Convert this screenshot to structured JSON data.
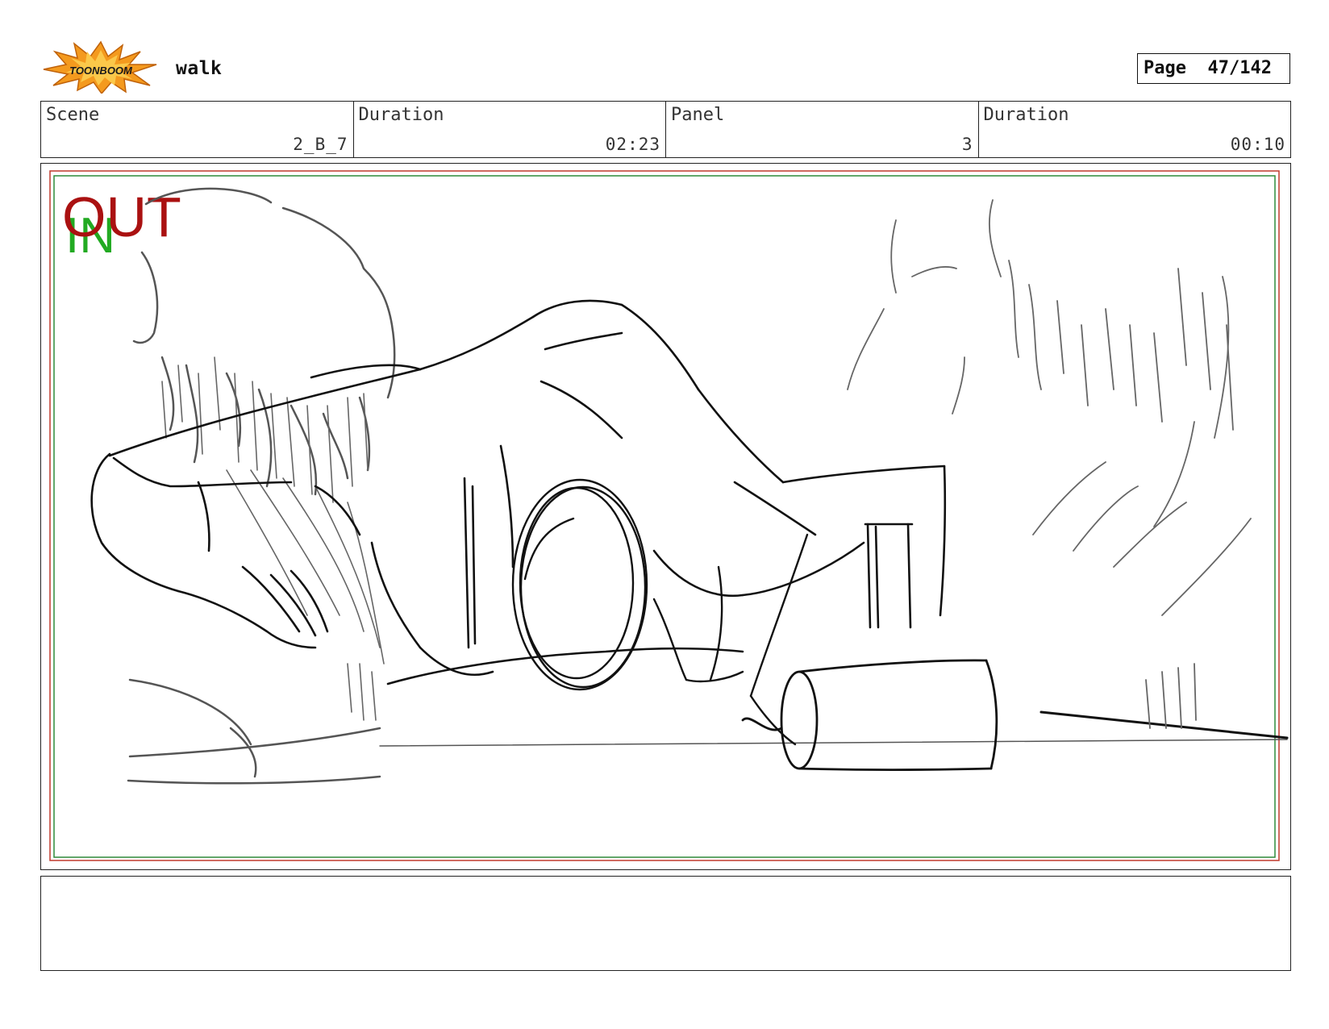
{
  "header": {
    "logo_text": "TOONBOOM",
    "project_title": "walk",
    "page_label": "Page",
    "page_number": "47/142"
  },
  "info": {
    "scene_label": "Scene",
    "scene_value": "2_B_7",
    "scene_duration_label": "Duration",
    "scene_duration_value": "02:23",
    "panel_label": "Panel",
    "panel_value": "3",
    "panel_duration_label": "Duration",
    "panel_duration_value": "00:10"
  },
  "panel": {
    "in_marker": "IN",
    "out_marker": "OUT",
    "in_color": "#22aa22",
    "out_color": "#aa1111"
  },
  "notes": {
    "text": ""
  }
}
